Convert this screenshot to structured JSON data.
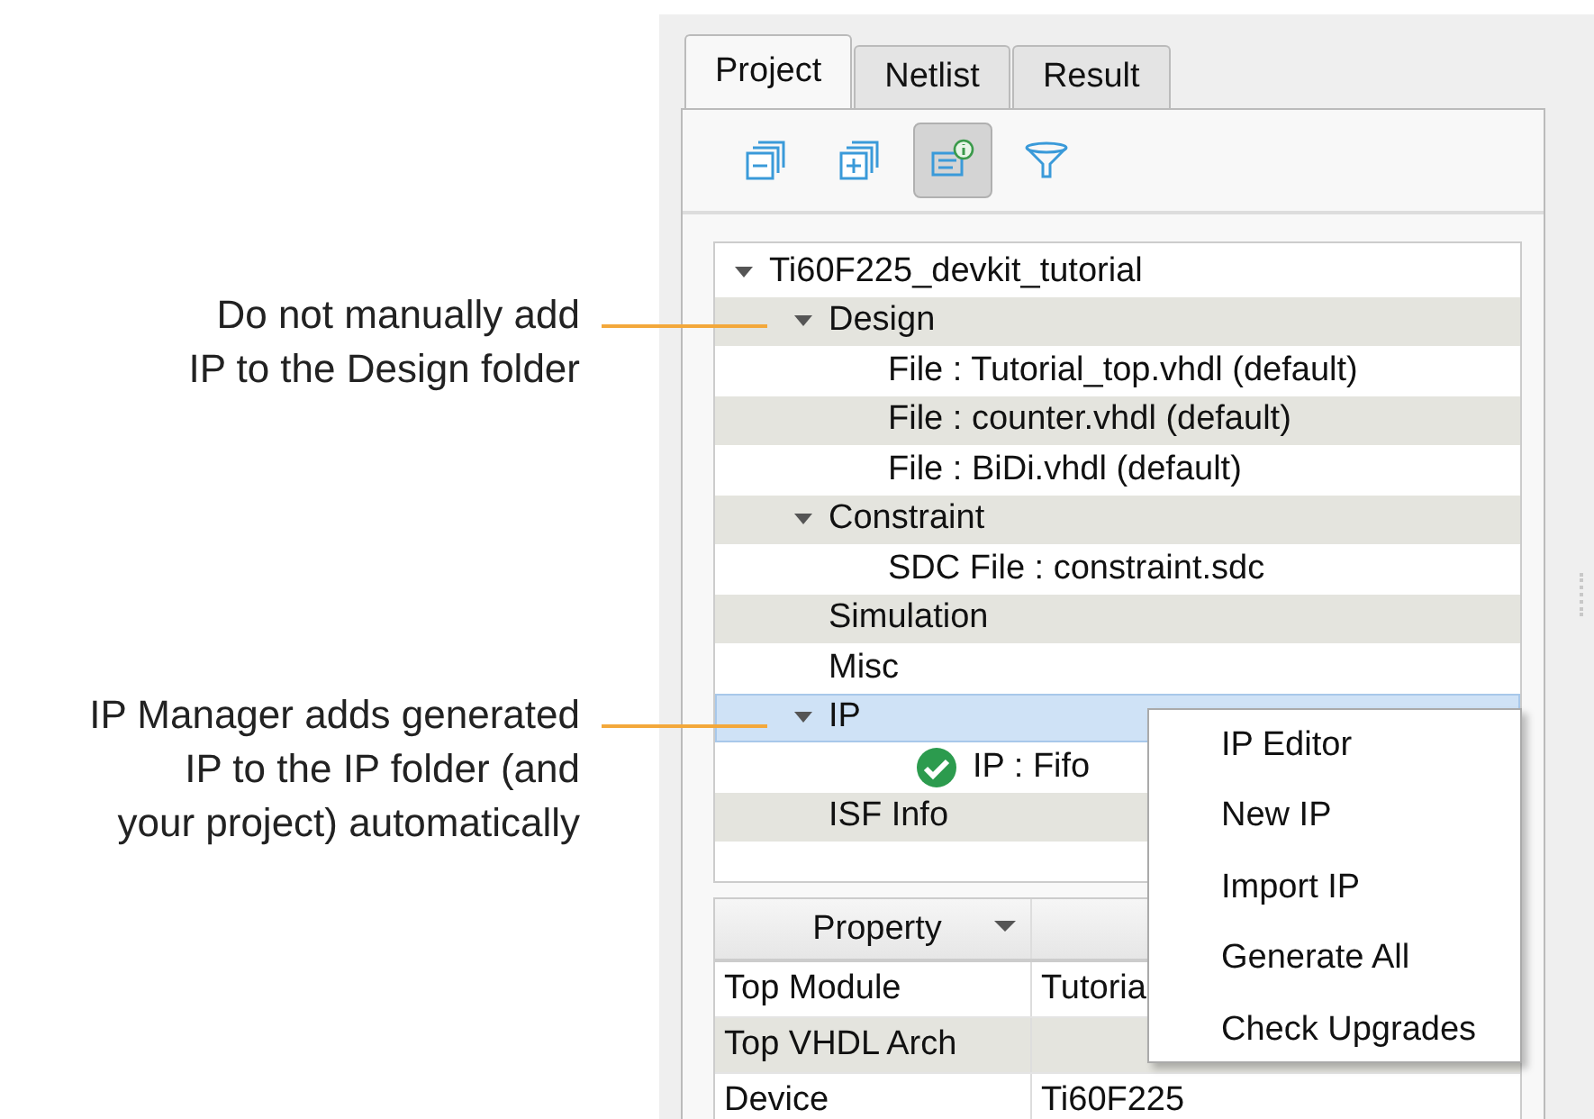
{
  "annotations": [
    {
      "lines": [
        "Do not manually add",
        "IP to the Design folder"
      ]
    },
    {
      "lines": [
        "IP Manager adds generated",
        "IP to the IP folder (and",
        "your project) automatically"
      ]
    }
  ],
  "tabs": [
    {
      "label": "Project",
      "selected": true
    },
    {
      "label": "Netlist",
      "selected": false
    },
    {
      "label": "Result",
      "selected": false
    }
  ],
  "toolbar": [
    {
      "kind": "collapse",
      "selected": false
    },
    {
      "kind": "expand",
      "selected": false
    },
    {
      "kind": "info",
      "selected": true
    },
    {
      "kind": "filter",
      "selected": false
    }
  ],
  "tree": [
    {
      "label": "Ti60F225_devkit_tutorial",
      "expanded": true,
      "selected": false,
      "children": [
        {
          "label": "Design",
          "expanded": true,
          "selected": false,
          "children": [
            {
              "label": "File : Tutorial_top.vhdl (default)",
              "selected": false
            },
            {
              "label": "File : counter.vhdl (default)",
              "selected": false
            },
            {
              "label": "File : BiDi.vhdl (default)",
              "selected": false
            }
          ]
        },
        {
          "label": "Constraint",
          "expanded": true,
          "selected": false,
          "children": [
            {
              "label": "SDC File : constraint.sdc",
              "selected": false
            }
          ]
        },
        {
          "label": "Simulation",
          "selected": false
        },
        {
          "label": "Misc",
          "selected": false
        },
        {
          "label": "IP",
          "expanded": true,
          "selected": true,
          "children": [
            {
              "label": "IP : Fifo",
              "ok": true,
              "selected": false
            }
          ]
        },
        {
          "label": "ISF Info",
          "selected": false
        }
      ]
    }
  ],
  "properties": {
    "columns": [
      "Property"
    ],
    "rows": [
      [
        "Top Module",
        "Tutoria"
      ],
      [
        "Top VHDL Arch",
        ""
      ],
      [
        "Device",
        "Ti60F225"
      ]
    ]
  },
  "context_menu": [
    "IP Editor",
    "New IP",
    "Import IP",
    "Generate All",
    "Check Upgrades"
  ]
}
